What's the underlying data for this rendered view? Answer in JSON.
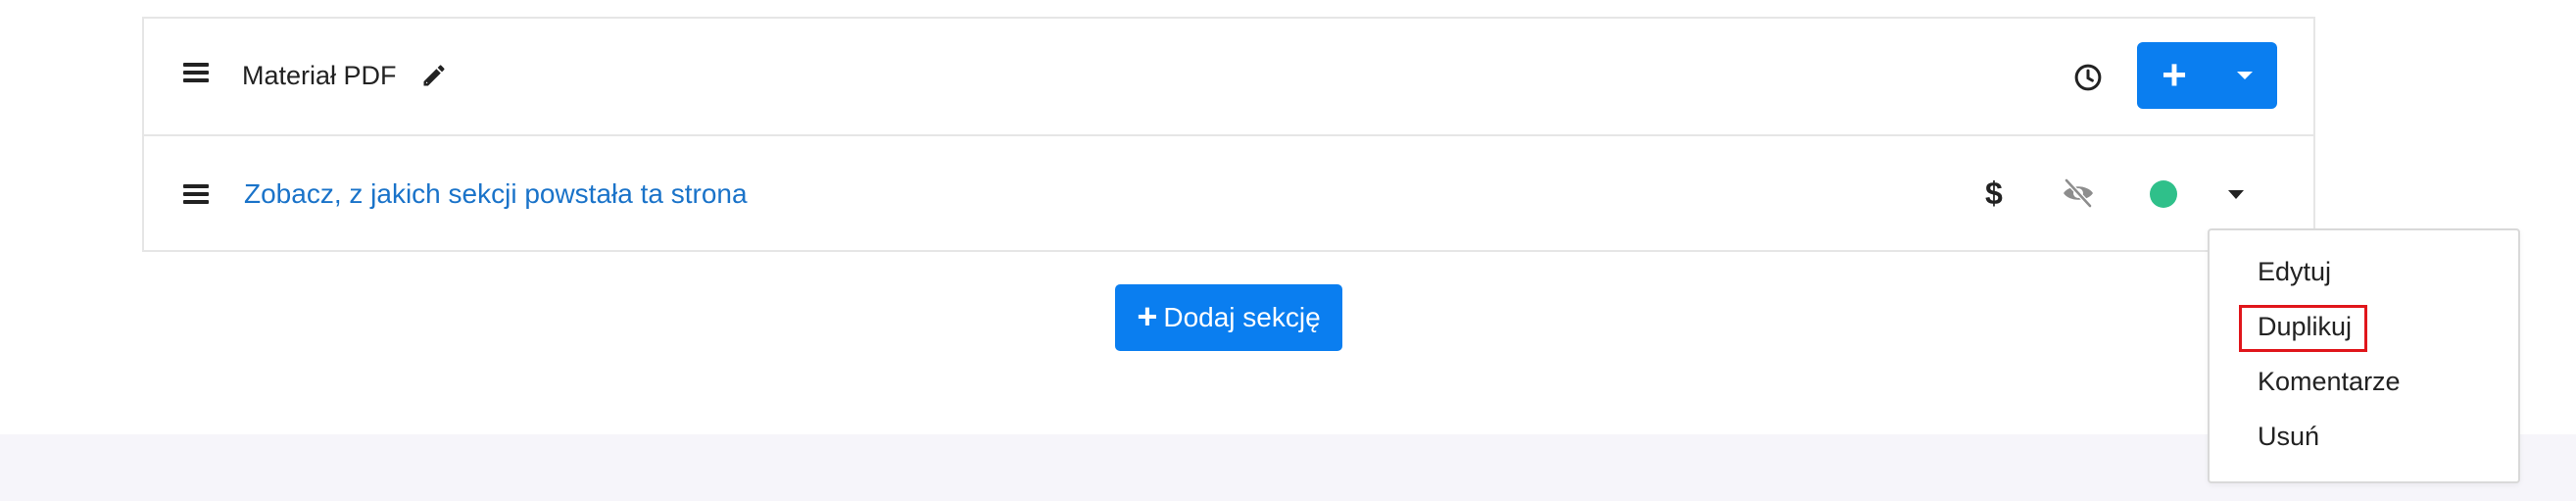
{
  "module": {
    "title": "Materiał PDF",
    "icons": {
      "menu": "hamburger-icon",
      "edit": "pencil-icon",
      "history": "clock-icon"
    },
    "add_button": {
      "label": "+"
    }
  },
  "section": {
    "link": "Zobacz, z jakich sekcji powstała ta strona",
    "icons": {
      "menu": "hamburger-icon",
      "price": "$",
      "visibility": "eye-slash-icon",
      "status": "status-dot-icon",
      "toggle": "caret-down-icon"
    },
    "status_color": "#2fc08a"
  },
  "add_section": {
    "plus": "+",
    "label": "Dodaj sekcję"
  },
  "dropdown": {
    "items": [
      "Edytuj",
      "Duplikuj",
      "Komentarze",
      "Usuń"
    ],
    "highlighted_item": "Duplikuj"
  },
  "colors": {
    "primary": "#0a7ef0",
    "link": "#1a73c9",
    "highlight": "#e0161b"
  }
}
